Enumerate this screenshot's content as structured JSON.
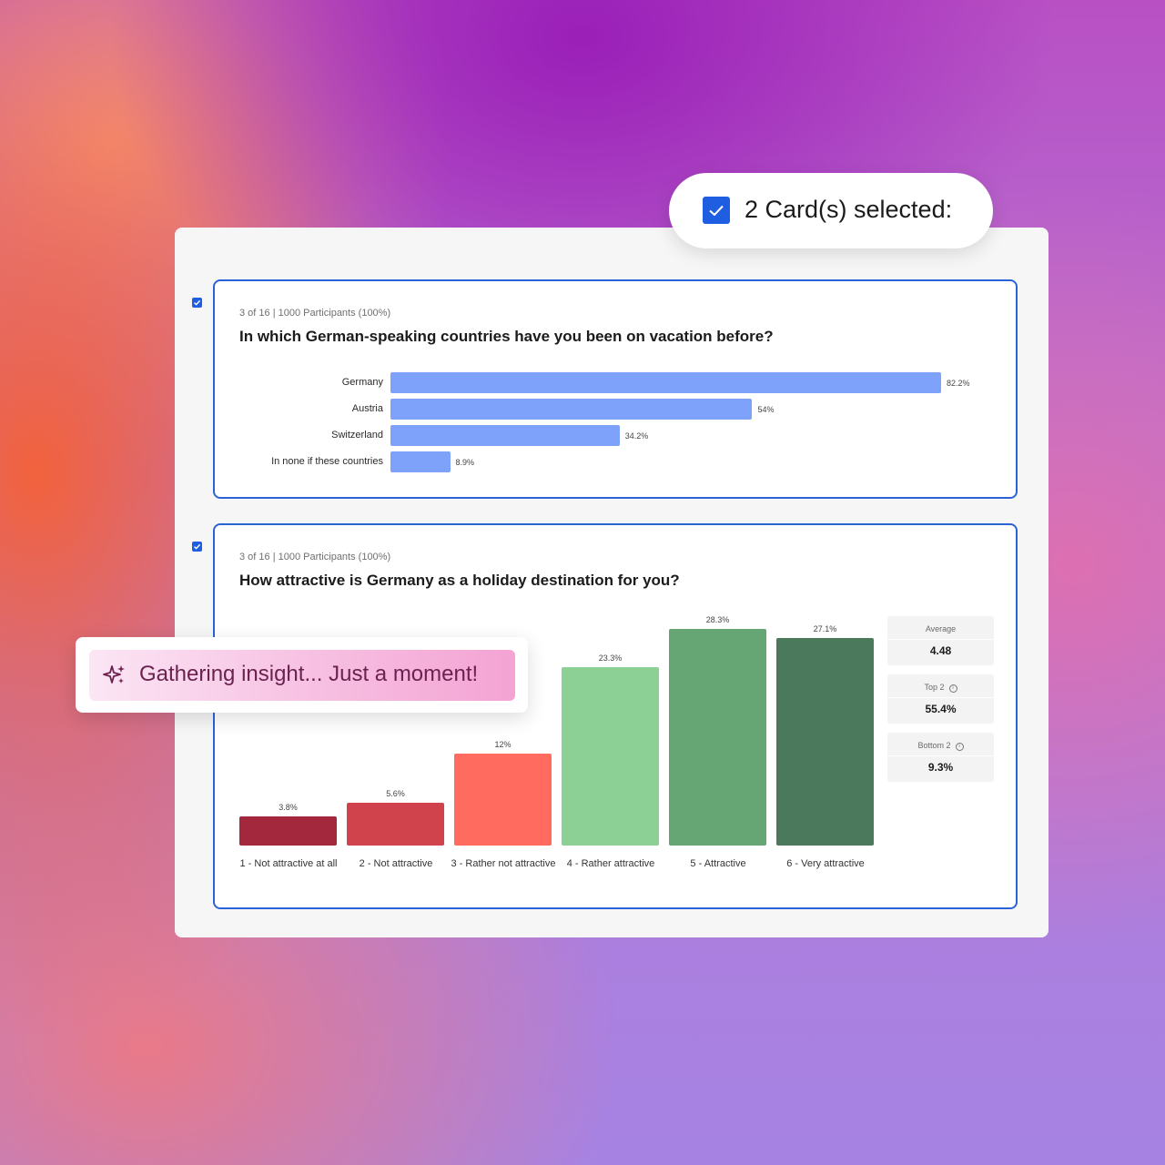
{
  "selection": {
    "label": "2 Card(s) selected:"
  },
  "toast": {
    "message": "Gathering insight... Just a moment!",
    "icon": "sparkles-icon"
  },
  "cards": [
    {
      "meta": "3 of 16 | 1000 Participants (100%)",
      "question": "In which German-speaking countries have you been on vacation before?",
      "checked": true
    },
    {
      "meta": "3 of 16 | 1000 Participants (100%)",
      "question": "How attractive is Germany as a holiday destination for you?",
      "checked": true,
      "stats": [
        {
          "label": "Average",
          "value": "4.48",
          "info": false
        },
        {
          "label": "Top 2",
          "value": "55.4%",
          "info": true
        },
        {
          "label": "Bottom 2",
          "value": "9.3%",
          "info": true
        }
      ]
    }
  ],
  "colors": {
    "accent": "#1f5ee0",
    "card_border": "#2b63d6",
    "hbar": "#7ea1fa"
  },
  "chart_data": [
    {
      "type": "bar",
      "orientation": "horizontal",
      "categories": [
        "Germany",
        "Austria",
        "Switzerland",
        "In none if these countries"
      ],
      "values": [
        82.2,
        54,
        34.2,
        8.9
      ],
      "value_labels": [
        "82.2%",
        "54%",
        "34.2%",
        "8.9%"
      ],
      "unit": "%",
      "xlim": [
        0,
        100
      ]
    },
    {
      "type": "bar",
      "orientation": "vertical",
      "categories": [
        "1 - Not attractive at all",
        "2 - Not attractive",
        "3 - Rather not attractive",
        "4 - Rather attractive",
        "5 - Attractive",
        "6 - Very attractive"
      ],
      "values": [
        3.8,
        5.6,
        12,
        23.3,
        28.3,
        27.1
      ],
      "value_labels": [
        "3.8%",
        "5.6%",
        "12%",
        "23.3%",
        "28.3%",
        "27.1%"
      ],
      "colors": [
        "#a3283e",
        "#d0434c",
        "#ff6b5e",
        "#8dd096",
        "#66a574",
        "#4a7a5b"
      ],
      "unit": "%",
      "ylim": [
        0,
        28.3
      ]
    }
  ]
}
